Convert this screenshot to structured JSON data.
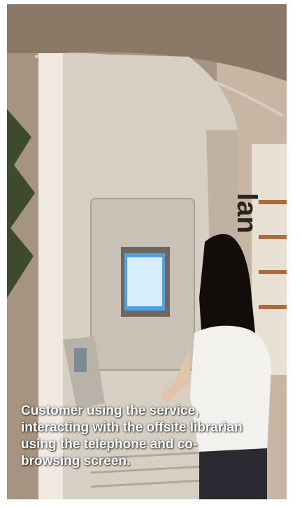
{
  "photo": {
    "sign_letters": "lan",
    "caption": "Customer using the service, interacting with the offsite librarian using the telephone and co-browsing screen."
  },
  "colors": {
    "kiosk": "#d9d2c8",
    "screen": "#4aa3e8",
    "hair": "#120c0a",
    "shirt": "#f3f1ee"
  }
}
